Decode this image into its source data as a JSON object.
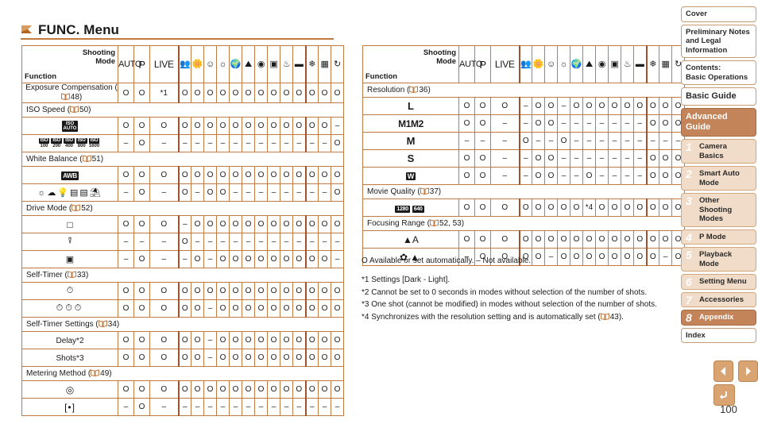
{
  "page": {
    "title": "FUNC. Menu",
    "page_number": "100"
  },
  "legend": "O Available or set automatically. – Not available.",
  "footnotes": [
    "*1 Settings [Dark - Light].",
    "*2 Cannot be set to 0 seconds in modes without selection of the number of shots.",
    "*3 One shot (cannot be modified) in modes without selection of the number of shots.",
    "*4 Synchronizes with the resolution setting and is automatically set ( 43)."
  ],
  "table_header": {
    "shooting_mode_line1": "Shooting",
    "shooting_mode_line2": "Mode",
    "function_label": "Function",
    "modes": [
      "AUTO",
      "P",
      "LIVE",
      "portrait-icon",
      "smooth-skin-icon",
      "smart-shutter-icon",
      "low-light-icon",
      "fish-eye-icon",
      "miniature-icon",
      "toy-camera-icon",
      "monochrome-icon",
      "super-vivid-icon",
      "poster-effect-icon",
      "snow-icon",
      "fireworks-icon",
      "movie-icon"
    ]
  },
  "left_table": {
    "sections": [
      {
        "label": "Exposure Compensation ( 48)",
        "inline": true,
        "values": [
          "O",
          "O",
          "*1",
          "O",
          "O",
          "O",
          "O",
          "O",
          "O",
          "O",
          "O",
          "O",
          "O",
          "O",
          "O",
          "O"
        ]
      },
      {
        "label": "ISO Speed ( 50)",
        "rows": [
          {
            "icon": "iso-auto",
            "values": [
              "O",
              "O",
              "O",
              "O",
              "O",
              "O",
              "O",
              "O",
              "O",
              "O",
              "O",
              "O",
              "O",
              "O",
              "O",
              "–"
            ]
          },
          {
            "icon": "iso-numbers",
            "values": [
              "–",
              "O",
              "–",
              "–",
              "–",
              "–",
              "–",
              "–",
              "–",
              "–",
              "–",
              "–",
              "–",
              "–",
              "–",
              "O"
            ]
          }
        ]
      },
      {
        "label": "White Balance ( 51)",
        "rows": [
          {
            "icon": "awb",
            "values": [
              "O",
              "O",
              "O",
              "O",
              "O",
              "O",
              "O",
              "O",
              "O",
              "O",
              "O",
              "O",
              "O",
              "O",
              "O",
              "O"
            ]
          },
          {
            "icon": "wb-presets",
            "values": [
              "–",
              "O",
              "–",
              "O",
              "–",
              "O",
              "O",
              "–",
              "–",
              "–",
              "–",
              "–",
              "–",
              "–",
              "–",
              "O"
            ]
          }
        ]
      },
      {
        "label": "Drive Mode ( 52)",
        "rows": [
          {
            "icon": "single-shot",
            "values": [
              "O",
              "O",
              "O",
              "–",
              "O",
              "O",
              "O",
              "O",
              "O",
              "O",
              "O",
              "O",
              "O",
              "O",
              "O",
              "O"
            ]
          },
          {
            "icon": "auto-continuous",
            "values": [
              "–",
              "–",
              "–",
              "O",
              "–",
              "–",
              "–",
              "–",
              "–",
              "–",
              "–",
              "–",
              "–",
              "–",
              "–",
              "–"
            ]
          },
          {
            "icon": "continuous",
            "values": [
              "–",
              "O",
              "–",
              "–",
              "O",
              "–",
              "O",
              "O",
              "O",
              "O",
              "O",
              "O",
              "O",
              "O",
              "O",
              "–"
            ]
          }
        ]
      },
      {
        "label": "Self-Timer ( 33)",
        "rows": [
          {
            "icon": "self-timer-off",
            "values": [
              "O",
              "O",
              "O",
              "O",
              "O",
              "O",
              "O",
              "O",
              "O",
              "O",
              "O",
              "O",
              "O",
              "O",
              "O",
              "O"
            ]
          },
          {
            "icon": "self-timer-modes",
            "values": [
              "O",
              "O",
              "O",
              "O",
              "O",
              "–",
              "O",
              "O",
              "O",
              "O",
              "O",
              "O",
              "O",
              "O",
              "O",
              "O"
            ]
          }
        ]
      },
      {
        "label": "Self-Timer Settings ( 34)",
        "rows": [
          {
            "text": "Delay*2",
            "values": [
              "O",
              "O",
              "O",
              "O",
              "O",
              "–",
              "O",
              "O",
              "O",
              "O",
              "O",
              "O",
              "O",
              "O",
              "O",
              "O"
            ]
          },
          {
            "text": "Shots*3",
            "values": [
              "O",
              "O",
              "O",
              "O",
              "O",
              "–",
              "O",
              "O",
              "O",
              "O",
              "O",
              "O",
              "O",
              "O",
              "O",
              "O"
            ]
          }
        ]
      },
      {
        "label": "Metering Method ( 49)",
        "rows": [
          {
            "icon": "evaluative-metering",
            "values": [
              "O",
              "O",
              "O",
              "O",
              "O",
              "O",
              "O",
              "O",
              "O",
              "O",
              "O",
              "O",
              "O",
              "O",
              "O",
              "O"
            ]
          },
          {
            "icon": "spot-metering",
            "values": [
              "–",
              "O",
              "–",
              "–",
              "–",
              "–",
              "–",
              "–",
              "–",
              "–",
              "–",
              "–",
              "–",
              "–",
              "–",
              "–"
            ]
          }
        ]
      }
    ]
  },
  "right_table": {
    "sections": [
      {
        "label": "Resolution ( 36)",
        "rows": [
          {
            "text": "L",
            "style": "resL",
            "values": [
              "O",
              "O",
              "O",
              "–",
              "O",
              "O",
              "–",
              "O",
              "O",
              "O",
              "O",
              "O",
              "O",
              "O",
              "O",
              "O"
            ]
          },
          {
            "text": "M1M2",
            "style": "resM12",
            "values": [
              "O",
              "O",
              "–",
              "–",
              "O",
              "O",
              "–",
              "–",
              "–",
              "–",
              "–",
              "–",
              "–",
              "O",
              "O",
              "O"
            ]
          },
          {
            "text": "M",
            "style": "resL",
            "values": [
              "–",
              "–",
              "–",
              "O",
              "–",
              "–",
              "O",
              "–",
              "–",
              "–",
              "–",
              "–",
              "–",
              "–",
              "–",
              "–"
            ]
          },
          {
            "text": "S",
            "style": "resL",
            "values": [
              "O",
              "O",
              "–",
              "–",
              "O",
              "O",
              "–",
              "–",
              "–",
              "–",
              "–",
              "–",
              "–",
              "O",
              "O",
              "O"
            ]
          },
          {
            "text": "W",
            "style": "resW",
            "values": [
              "O",
              "O",
              "–",
              "–",
              "O",
              "O",
              "–",
              "–",
              "O",
              "–",
              "–",
              "–",
              "–",
              "O",
              "O",
              "O"
            ]
          }
        ]
      },
      {
        "label": "Movie Quality ( 37)",
        "rows": [
          {
            "icon": "movie-quality",
            "values": [
              "O",
              "O",
              "O",
              "O",
              "O",
              "O",
              "O",
              "O",
              "*4",
              "O",
              "O",
              "O",
              "O",
              "O",
              "O",
              "O"
            ]
          }
        ]
      },
      {
        "label": "Focusing Range ( 52, 53)",
        "rows": [
          {
            "icon": "focus-normal",
            "values": [
              "O",
              "O",
              "O",
              "O",
              "O",
              "O",
              "O",
              "O",
              "O",
              "O",
              "O",
              "O",
              "O",
              "O",
              "O",
              "O"
            ]
          },
          {
            "icon": "focus-macro-infinity",
            "values": [
              "–",
              "O",
              "O",
              "O",
              "O",
              "–",
              "O",
              "O",
              "O",
              "O",
              "O",
              "O",
              "O",
              "O",
              "–",
              "O"
            ]
          }
        ]
      }
    ]
  },
  "sidebar": {
    "items": [
      {
        "label": "Cover",
        "type": "plain"
      },
      {
        "label": "Preliminary Notes and Legal Information",
        "type": "plain"
      },
      {
        "label": "Contents:\nBasic Operations",
        "type": "plain"
      },
      {
        "label": "Basic Guide",
        "type": "big"
      },
      {
        "label": "Advanced Guide",
        "type": "adv"
      },
      {
        "num": "1",
        "label": "Camera Basics",
        "type": "num"
      },
      {
        "num": "2",
        "label": "Smart Auto Mode",
        "type": "num"
      },
      {
        "num": "3",
        "label": "Other Shooting Modes",
        "type": "num"
      },
      {
        "num": "4",
        "label": "P Mode",
        "type": "num"
      },
      {
        "num": "5",
        "label": "Playback Mode",
        "type": "num"
      },
      {
        "num": "6",
        "label": "Setting Menu",
        "type": "num"
      },
      {
        "num": "7",
        "label": "Accessories",
        "type": "num"
      },
      {
        "num": "8",
        "label": "Appendix",
        "type": "num",
        "active": true
      },
      {
        "label": "Index",
        "type": "plain"
      }
    ]
  },
  "nav_buttons": {
    "prev": "previous-page-arrow",
    "next": "next-page-arrow",
    "back": "back-arrow"
  },
  "colors": {
    "accent": "#c07a42",
    "header_fill": "#efd9c4",
    "active_nav": "#c4845a",
    "nav_fill": "#f0dcc8"
  }
}
